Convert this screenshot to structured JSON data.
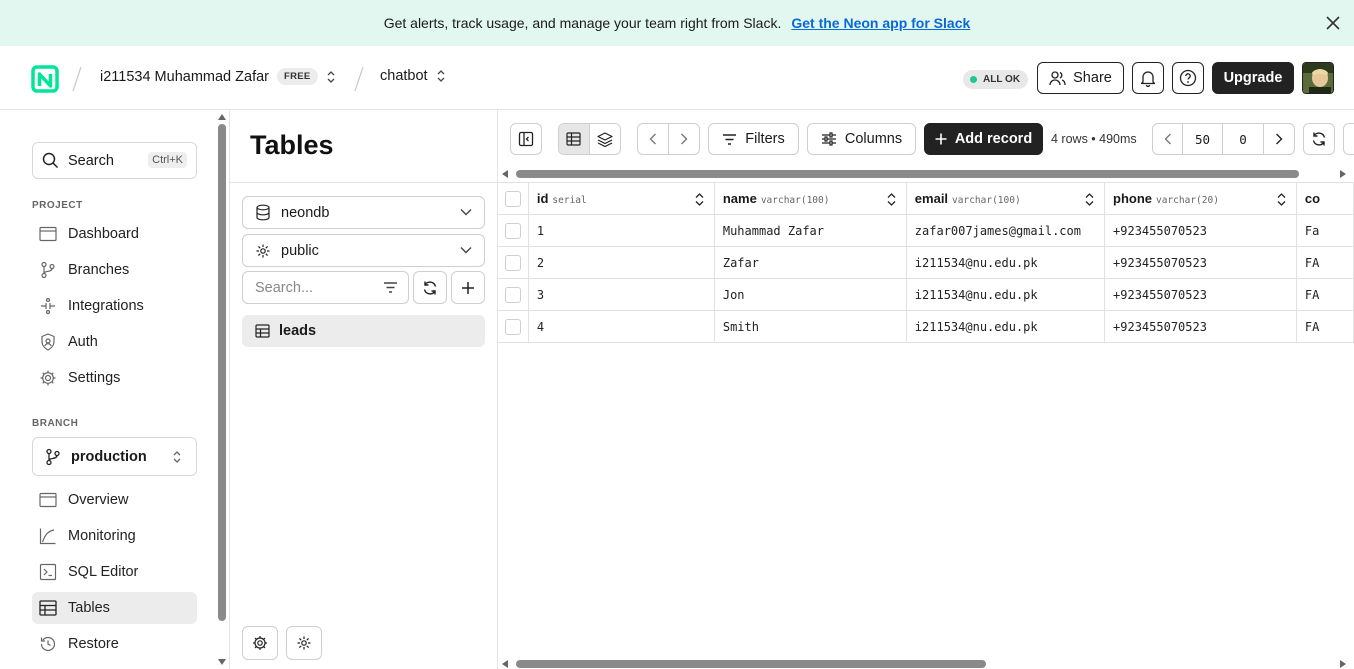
{
  "banner": {
    "text": "Get alerts, track usage, and manage your team right from Slack.",
    "link": "Get the Neon app for Slack"
  },
  "header": {
    "org_name": "i211534 Muhammad Zafar",
    "plan_badge": "FREE",
    "project_name": "chatbot",
    "status": "ALL OK",
    "share_label": "Share",
    "upgrade_label": "Upgrade"
  },
  "sidebar": {
    "search_label": "Search",
    "search_shortcut": "Ctrl+K",
    "project_section": "PROJECT",
    "project_items": [
      {
        "label": "Dashboard",
        "icon": "dashboard-icon"
      },
      {
        "label": "Branches",
        "icon": "branches-icon"
      },
      {
        "label": "Integrations",
        "icon": "integrations-icon"
      },
      {
        "label": "Auth",
        "icon": "auth-icon"
      },
      {
        "label": "Settings",
        "icon": "settings-icon"
      }
    ],
    "branch_section": "BRANCH",
    "branch_selected": "production",
    "branch_items": [
      {
        "label": "Overview",
        "icon": "overview-icon"
      },
      {
        "label": "Monitoring",
        "icon": "monitoring-icon"
      },
      {
        "label": "SQL Editor",
        "icon": "sql-editor-icon"
      },
      {
        "label": "Tables",
        "icon": "tables-icon",
        "active": true
      },
      {
        "label": "Restore",
        "icon": "restore-icon"
      }
    ]
  },
  "tables_panel": {
    "title": "Tables",
    "database": "neondb",
    "schema": "public",
    "search_placeholder": "Search...",
    "tables": [
      "leads"
    ]
  },
  "toolbar": {
    "filters_label": "Filters",
    "columns_label": "Columns",
    "add_record_label": "Add record",
    "row_info": "4 rows • 490ms",
    "page_size": "50",
    "offset": "0"
  },
  "grid": {
    "columns": [
      {
        "name": "id",
        "type": "serial"
      },
      {
        "name": "name",
        "type": "varchar(100)"
      },
      {
        "name": "email",
        "type": "varchar(100)"
      },
      {
        "name": "phone",
        "type": "varchar(20)"
      },
      {
        "name": "co",
        "type": ""
      }
    ],
    "rows": [
      [
        "1",
        "Muhammad Zafar",
        "zafar007james@gmail.com",
        "+923455070523",
        "Fa"
      ],
      [
        "2",
        "Zafar",
        "i211534@nu.edu.pk",
        "+923455070523",
        "FA"
      ],
      [
        "3",
        "Jon",
        "i211534@nu.edu.pk",
        "+923455070523",
        "FA"
      ],
      [
        "4",
        "Smith",
        "i211534@nu.edu.pk",
        "+923455070523",
        "FA"
      ]
    ]
  },
  "colors": {
    "banner_bg": "#e3f7f1",
    "link": "#0b69d6",
    "status_dot": "#1ec79a",
    "primary_dark": "#222222",
    "brand_green": "#00e599"
  }
}
